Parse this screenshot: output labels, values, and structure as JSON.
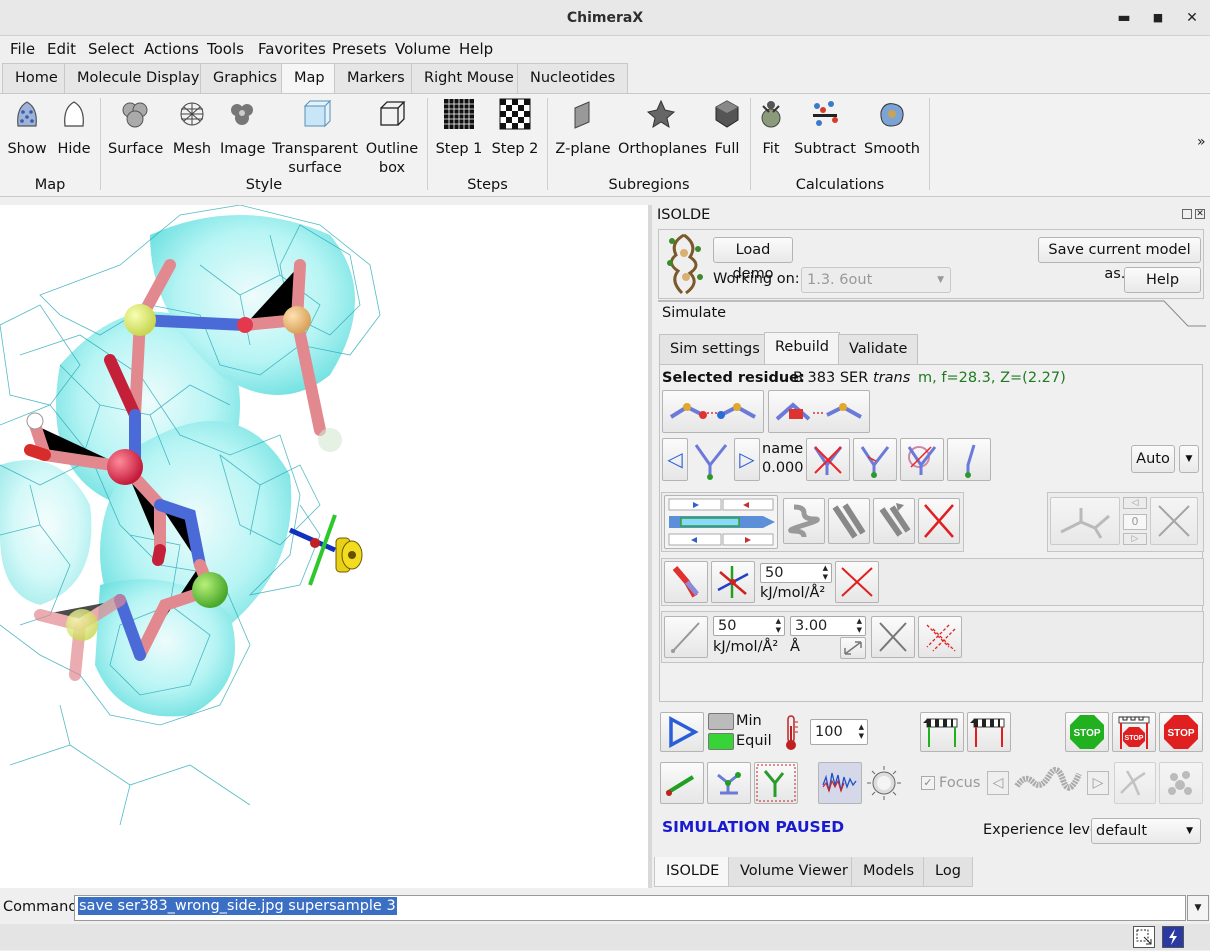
{
  "window": {
    "title": "ChimeraX",
    "minimize": "▬",
    "maximize": "■",
    "close": "✕"
  },
  "menu": [
    "File",
    "Edit",
    "Select",
    "Actions",
    "Tools",
    "Favorites",
    "Presets",
    "Volume",
    "Help"
  ],
  "tabs": [
    "Home",
    "Molecule Display",
    "Graphics",
    "Map",
    "Markers",
    "Right Mouse",
    "Nucleotides"
  ],
  "active_tab": "Map",
  "ribbon": {
    "buttons": {
      "show": "Show",
      "hide": "Hide",
      "surface": "Surface",
      "mesh": "Mesh",
      "image": "Image",
      "transparent_1": "Transparent",
      "transparent_2": "surface",
      "outline_1": "Outline",
      "outline_2": "box",
      "step1": "Step 1",
      "step2": "Step 2",
      "zplane": "Z-plane",
      "orthoplanes": "Orthoplanes",
      "full": "Full",
      "fit": "Fit",
      "subtract": "Subtract",
      "smooth": "Smooth"
    },
    "groups": {
      "map": "Map",
      "style": "Style",
      "steps": "Steps",
      "subregions": "Subregions",
      "calculations": "Calculations"
    },
    "overflow": "»"
  },
  "isolde": {
    "title": "ISOLDE",
    "load_demo": "Load demo",
    "save_model": "Save current model as...",
    "working_on_label": "Working on:",
    "working_on_value": "1.3. 6out",
    "help": "Help",
    "simulate": "Simulate",
    "subtabs": [
      "Sim settings",
      "Rebuild",
      "Validate"
    ],
    "selected_label": "Selected residue:",
    "selected_residue": "B 383 SER",
    "selected_conf": "trans",
    "selected_stats": "m, f=28.3, Z=(2.27)",
    "rotamer_name_label": "name",
    "rotamer_value": "0.000",
    "auto": "Auto",
    "register_value": "0",
    "position_restraint": {
      "value": "50",
      "unit": "kJ/mol/Å²"
    },
    "distance_restraint": {
      "k_value": "50",
      "k_unit": "kJ/mol/Å²",
      "dist_value": "3.00",
      "dist_unit": "Å"
    },
    "min_label": "Min",
    "equil_label": "Equil",
    "temperature": "100",
    "stop_label": "STOP",
    "focus_label": "Focus",
    "status": "SIMULATION PAUSED",
    "experience_label": "Experience level",
    "experience_value": "default"
  },
  "bottom_tabs": [
    "ISOLDE",
    "Volume Viewer",
    "Models",
    "Log"
  ],
  "command": {
    "label": "Command:",
    "value": "save ser383_wrong_side.jpg supersample 3"
  },
  "colors": {
    "status_blue": "#1a1acf",
    "stats_green": "#1f7a1f",
    "selection_blue": "#3b6fc4"
  }
}
